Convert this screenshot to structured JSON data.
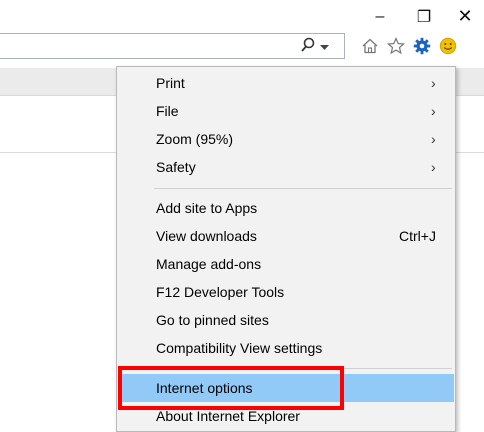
{
  "window_controls": {
    "minimize": "–",
    "restore": "❐",
    "close": "✕"
  },
  "toolbar": {
    "search_icon": "search-icon",
    "dropdown_icon": "chevron-down-icon",
    "icons": [
      "home-icon",
      "star-icon",
      "gear-icon",
      "smiley-icon"
    ],
    "gear_color": "#1a63c6",
    "smiley_color": "#f0c000"
  },
  "menu": {
    "groups": [
      [
        {
          "label": "Print",
          "submenu": true
        },
        {
          "label": "File",
          "submenu": true
        },
        {
          "label": "Zoom (95%)",
          "submenu": true
        },
        {
          "label": "Safety",
          "submenu": true
        }
      ],
      [
        {
          "label": "Add site to Apps"
        },
        {
          "label": "View downloads",
          "shortcut": "Ctrl+J"
        },
        {
          "label": "Manage add-ons"
        },
        {
          "label": "F12 Developer Tools"
        },
        {
          "label": "Go to pinned sites"
        },
        {
          "label": "Compatibility View settings"
        }
      ],
      [
        {
          "label": "Internet options",
          "highlighted": true
        },
        {
          "label": "About Internet Explorer"
        }
      ]
    ],
    "submenu_arrow": "›",
    "highlight_color": "#91c9f7"
  },
  "annotation": {
    "color": "#ff0000"
  }
}
